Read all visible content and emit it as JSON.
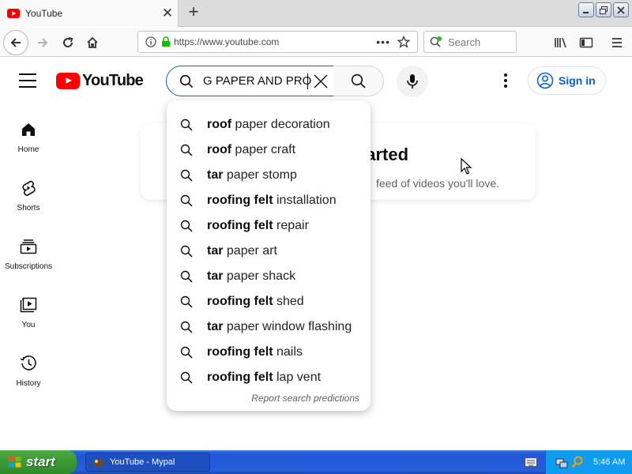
{
  "browser": {
    "tab": {
      "title": "YouTube"
    },
    "url": "https://www.youtube.com",
    "search_placeholder": "Search"
  },
  "youtube": {
    "logo_text": "YouTube",
    "search": {
      "value": "G PAPER AND PRO"
    },
    "sign_in_label": "Sign in",
    "guide": [
      {
        "label": "Home",
        "icon": "home-icon"
      },
      {
        "label": "Shorts",
        "icon": "shorts-icon"
      },
      {
        "label": "Subscriptions",
        "icon": "subscriptions-icon"
      },
      {
        "label": "You",
        "icon": "you-icon"
      },
      {
        "label": "History",
        "icon": "history-icon"
      }
    ],
    "card": {
      "title_visible": "et started",
      "subtitle_visible": "feed of videos you'll love."
    },
    "suggestions": [
      {
        "bold": "roof",
        "rest": " paper decoration"
      },
      {
        "bold": "roof",
        "rest": " paper craft"
      },
      {
        "bold": "tar",
        "rest": " paper stomp"
      },
      {
        "bold": "roofing felt",
        "rest": " installation"
      },
      {
        "bold": "roofing felt",
        "rest": " repair"
      },
      {
        "bold": "tar",
        "rest": " paper art"
      },
      {
        "bold": "tar",
        "rest": " paper shack"
      },
      {
        "bold": "roofing felt",
        "rest": " shed"
      },
      {
        "bold": "tar",
        "rest": " paper window flashing"
      },
      {
        "bold": "roofing felt",
        "rest": " nails"
      },
      {
        "bold": "roofing felt",
        "rest": " lap vent"
      }
    ],
    "report_label": "Report search predictions"
  },
  "taskbar": {
    "start_label": "start",
    "task_label": "YouTube - Mypal",
    "clock": "5:46 AM"
  },
  "colors": {
    "youtube_red": "#ff0000",
    "link_blue": "#065fd4",
    "search_focus": "#1c62b9",
    "xp_blue": "#245edb",
    "xp_green": "#3b9a35"
  }
}
